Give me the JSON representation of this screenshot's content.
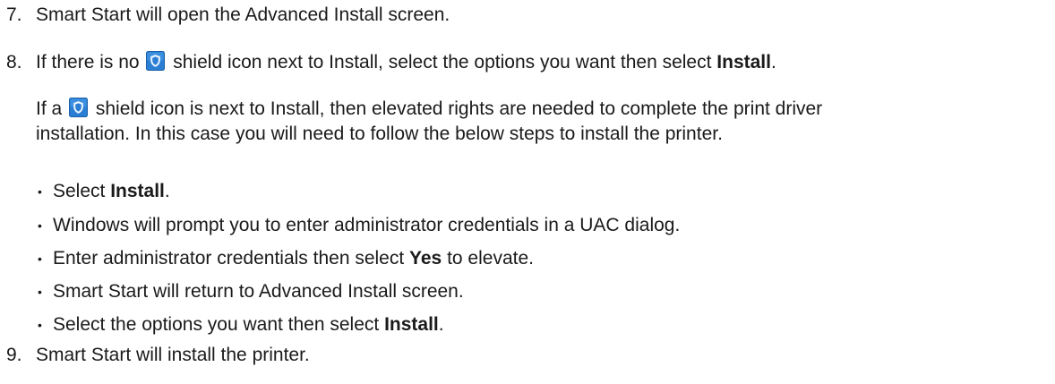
{
  "steps": [
    {
      "number": "7.",
      "text": "Smart Start will open the Advanced Install screen."
    },
    {
      "number": "8.",
      "pre": "If there is no",
      "post": "shield icon next to Install, select the options you want then select",
      "bold": "Install",
      "end": "."
    },
    {
      "number": "9.",
      "text": "Smart Start will install the printer."
    }
  ],
  "note": {
    "line1_pre": "If a",
    "line1_post": "shield icon is next to Install, then elevated rights are needed to complete the print driver",
    "line2": "installation. In this case you will need to follow the below steps to install the printer."
  },
  "bullets": [
    {
      "pre": "Select ",
      "bold": "Install",
      "post": "."
    },
    {
      "pre": "Windows will prompt you to enter administrator credentials in a UAC dialog.",
      "bold": "",
      "post": ""
    },
    {
      "pre": "Enter administrator credentials then select ",
      "bold": "Yes",
      "post": " to elevate."
    },
    {
      "pre": "Smart Start will return to Advanced Install screen.",
      "bold": "",
      "post": ""
    },
    {
      "pre": "Select the options you want then select ",
      "bold": "Install",
      "post": "."
    }
  ],
  "bullet_symbol": "•",
  "icons": {
    "shield": "shield-icon"
  },
  "colors": {
    "text": "#1a1a1a",
    "shield_bg": "#2a7fd4",
    "shield_border": "#1b5fa8"
  }
}
